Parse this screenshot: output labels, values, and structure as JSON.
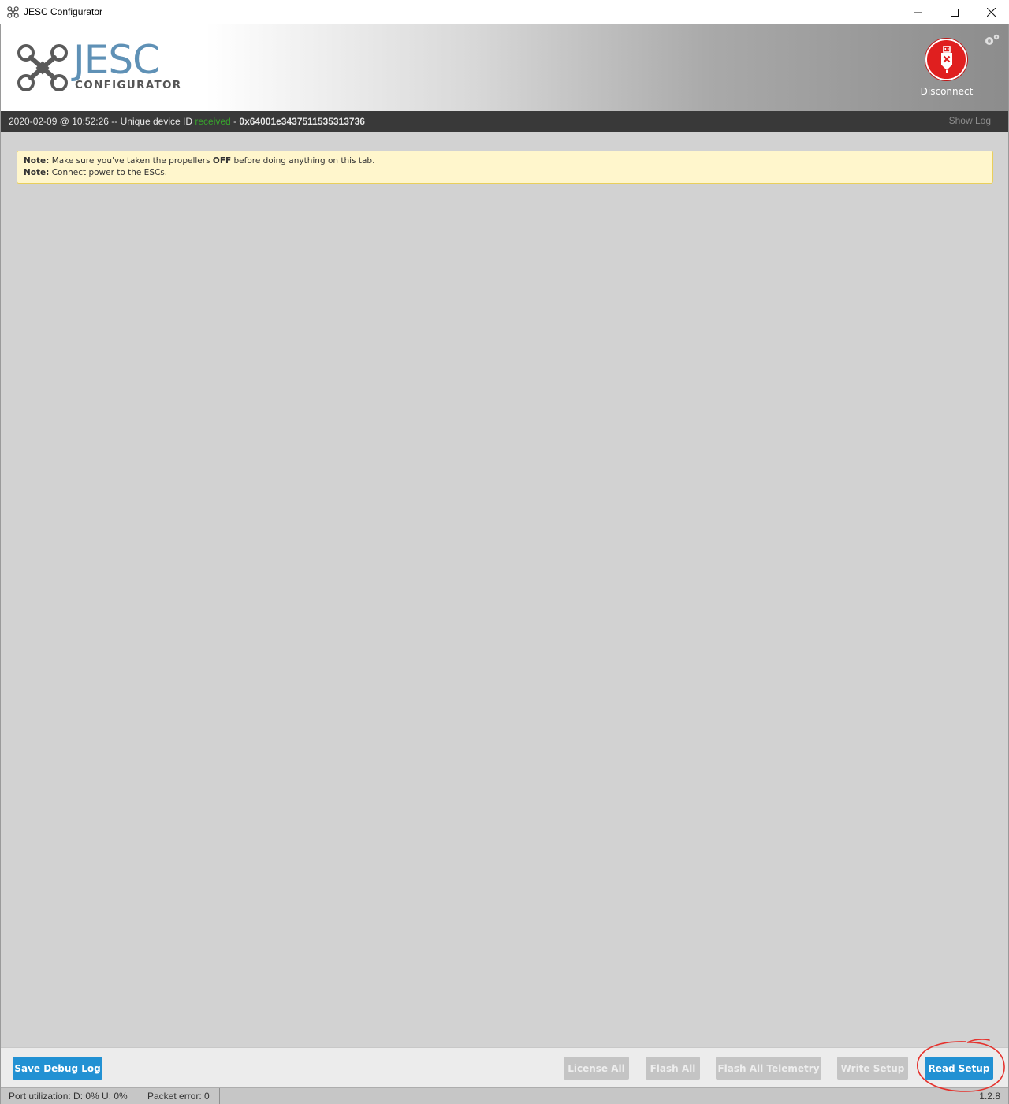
{
  "window": {
    "title": "JESC Configurator",
    "icon": "drone-icon"
  },
  "header": {
    "logo_text": "JESC",
    "logo_subtitle": "CONFIGURATOR",
    "connect_button_label": "Disconnect",
    "connect_button_color": "#e01f1f",
    "settings_icon": "gear-icon"
  },
  "log": {
    "timestamp": "2020-02-09 @ 10:52:26",
    "message_prefix": "-- Unique device ID",
    "status": "received",
    "separator": "-",
    "device_id": "0x64001e3437511535313736",
    "show_log_label": "Show Log"
  },
  "note": {
    "line1_label": "Note:",
    "line1_before": "Make sure you've taken the propellers",
    "line1_bold": "OFF",
    "line1_after": "before doing anything on this tab.",
    "line2_label": "Note:",
    "line2_text": "Connect power to the ESCs."
  },
  "toolbar": {
    "save_debug_log": "Save Debug Log",
    "license_all": "License All",
    "flash_all": "Flash All",
    "flash_all_telemetry": "Flash All Telemetry",
    "write_setup": "Write Setup",
    "read_setup": "Read Setup",
    "accent_color": "#2291d3"
  },
  "status_bar": {
    "port_utilization": "Port utilization: D: 0% U: 0%",
    "packet_error": "Packet error: 0",
    "version": "1.2.8"
  }
}
